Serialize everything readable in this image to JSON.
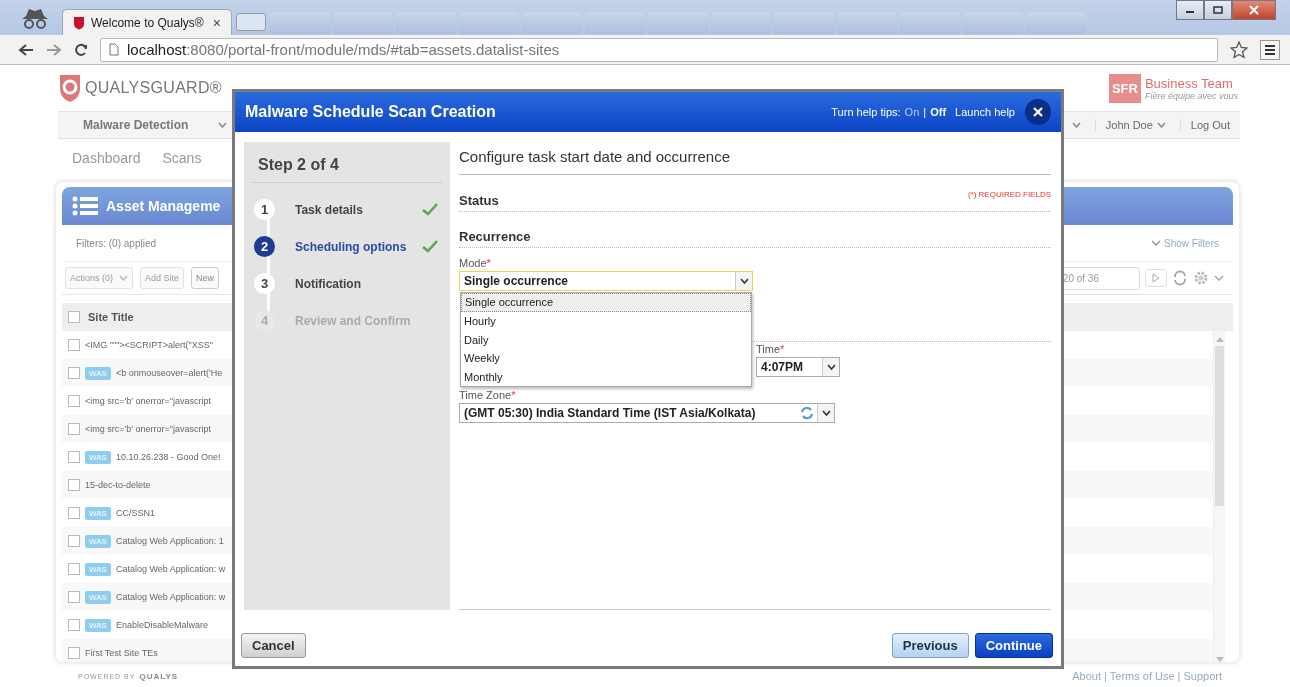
{
  "browser": {
    "tabs": [
      {
        "title": "Welcome to Qualys®",
        "selected": true,
        "close": "×"
      }
    ],
    "url_host": "localhost",
    "url_rest": ":8080/portal-front/module/mds/#tab=assets.datalist-sites"
  },
  "header": {
    "logo": "QUALYSGUARD®",
    "partner_badge": "SFR",
    "partner_name": "Business Team",
    "partner_tagline": "Fière équipe avec vous"
  },
  "nav": {
    "left": "Malware Detection",
    "right": [
      "John Doe",
      "Log Out"
    ]
  },
  "subnav": [
    "Dashboard",
    "Scans"
  ],
  "panel": {
    "title": "Asset Manageme",
    "filters": "Filters: (0) applied",
    "show_filters": "Show Filters",
    "toolbar": [
      {
        "label": "Actions (0)",
        "disabled": true
      },
      {
        "label": "Add Site",
        "disabled": true
      },
      {
        "label": "New",
        "disabled": false
      }
    ],
    "pager": "20 of 36",
    "column": "Site Title",
    "all_checked": false,
    "rows": [
      {
        "checked": false,
        "badge": "",
        "title": "<IMG \"\"\"><SCRIPT>alert(\"XSS\""
      },
      {
        "checked": false,
        "badge": "WAS",
        "title": "<b onmouseover=alert('He"
      },
      {
        "checked": false,
        "badge": "",
        "title": "<img src='b' onerror=\"javascript"
      },
      {
        "checked": false,
        "badge": "",
        "title": "<img src='b' onerror=\"javascript"
      },
      {
        "checked": false,
        "badge": "WAS",
        "title": "10.10.26.238 - Good One!"
      },
      {
        "checked": false,
        "badge": "",
        "title": "15-dec-to-delete"
      },
      {
        "checked": false,
        "badge": "WAS",
        "title": "CC/SSN1"
      },
      {
        "checked": false,
        "badge": "WAS",
        "title": "Catalog Web Application: 1"
      },
      {
        "checked": false,
        "badge": "WAS",
        "title": "Catalog Web Application: w"
      },
      {
        "checked": false,
        "badge": "WAS",
        "title": "Catalog Web Application: w"
      },
      {
        "checked": false,
        "badge": "WAS",
        "title": "EnableDisableMalware"
      },
      {
        "checked": false,
        "badge": "",
        "title": "First Test Site TEs"
      }
    ]
  },
  "modal": {
    "title": "Malware Schedule Scan Creation",
    "help_label": "Turn help tips:",
    "help_options": [
      {
        "label": "On",
        "selected": false
      },
      {
        "label": "Off",
        "selected": true
      }
    ],
    "help_separator": "|",
    "launch_help": "Launch help",
    "step_heading": "Step 2 of 4",
    "steps": [
      {
        "number": "1",
        "label": "Task details",
        "selected": false,
        "checked": true,
        "disabled": false
      },
      {
        "number": "2",
        "label": "Scheduling options",
        "selected": true,
        "checked": true,
        "disabled": false
      },
      {
        "number": "3",
        "label": "Notification",
        "selected": false,
        "checked": false,
        "disabled": false
      },
      {
        "number": "4",
        "label": "Review and Confirm",
        "selected": false,
        "checked": false,
        "disabled": true
      }
    ],
    "heading": "Configure task start date and occurrence",
    "required_note": "(*) REQUIRED FIELDS",
    "sections": [
      "Status",
      "Recurrence"
    ],
    "mode": {
      "label": "Mode",
      "star": "*",
      "value": "Single occurrence",
      "options": [
        {
          "label": "Single occurrence",
          "selected": true
        },
        {
          "label": "Hourly",
          "selected": false
        },
        {
          "label": "Daily",
          "selected": false
        },
        {
          "label": "Weekly",
          "selected": false
        },
        {
          "label": "Monthly",
          "selected": false
        }
      ]
    },
    "time": {
      "label": "Time",
      "star": "*",
      "value": "4:07PM"
    },
    "timezone": {
      "label": "Time Zone",
      "star": "*",
      "value": "(GMT 05:30) India Standard Time (IST Asia/Kolkata)"
    },
    "buttons": {
      "cancel": "Cancel",
      "previous": "Previous",
      "continue": "Continue"
    }
  },
  "footer": {
    "powered": "POWERED BY",
    "brand": "QUALYS",
    "links": [
      "About",
      "Terms of Use",
      "Support"
    ],
    "separator": "|"
  }
}
